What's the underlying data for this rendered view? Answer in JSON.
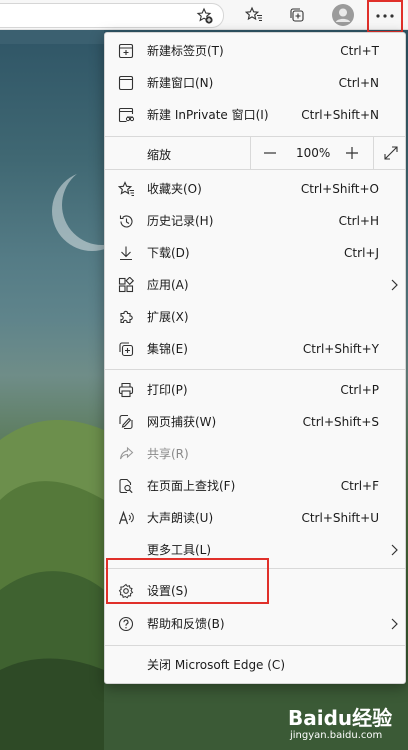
{
  "menu": {
    "new_tab": {
      "label": "新建标签页(T)",
      "shortcut": "Ctrl+T"
    },
    "new_window": {
      "label": "新建窗口(N)",
      "shortcut": "Ctrl+N"
    },
    "new_inprivate": {
      "label": "新建 InPrivate 窗口(I)",
      "shortcut": "Ctrl+Shift+N"
    },
    "zoom": {
      "label": "缩放",
      "minus": "—",
      "value": "100%",
      "plus": "+"
    },
    "favorites": {
      "label": "收藏夹(O)",
      "shortcut": "Ctrl+Shift+O"
    },
    "history": {
      "label": "历史记录(H)",
      "shortcut": "Ctrl+H"
    },
    "downloads": {
      "label": "下载(D)",
      "shortcut": "Ctrl+J"
    },
    "apps": {
      "label": "应用(A)"
    },
    "extensions": {
      "label": "扩展(X)"
    },
    "collections": {
      "label": "集锦(E)",
      "shortcut": "Ctrl+Shift+Y"
    },
    "print": {
      "label": "打印(P)",
      "shortcut": "Ctrl+P"
    },
    "web_capture": {
      "label": "网页捕获(W)",
      "shortcut": "Ctrl+Shift+S"
    },
    "share": {
      "label": "共享(R)"
    },
    "find": {
      "label": "在页面上查找(F)",
      "shortcut": "Ctrl+F"
    },
    "read_aloud": {
      "label": "大声朗读(U)",
      "shortcut": "Ctrl+Shift+U"
    },
    "more_tools": {
      "label": "更多工具(L)"
    },
    "settings": {
      "label": "设置(S)"
    },
    "help": {
      "label": "帮助和反馈(B)"
    },
    "close": {
      "label": "关闭 Microsoft Edge (C)"
    }
  },
  "watermark": {
    "logo": "Baidu经验",
    "sub": "jingyan.baidu.com"
  },
  "colors": {
    "highlight": "#e0302a",
    "menu_bg": "#f9f9f9",
    "toolbar_bg": "#f7f7f7"
  }
}
